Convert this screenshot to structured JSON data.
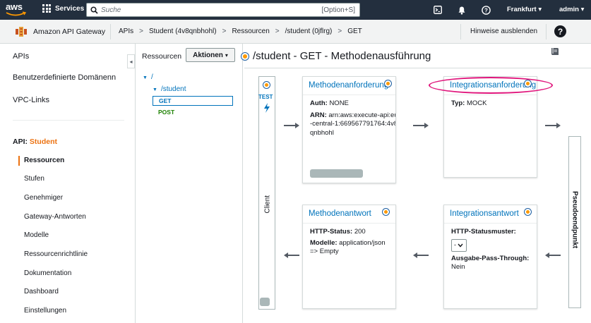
{
  "topnav": {
    "logo": "aws",
    "services_label": "Services",
    "search_placeholder": "Suche",
    "search_shortcut": "[Option+S]",
    "region": "Frankfurt",
    "user": "admin",
    "icons": [
      "terminal-icon",
      "bell-icon",
      "help-icon"
    ]
  },
  "breadcrumb": {
    "service_name": "Amazon API Gateway",
    "items": [
      "APIs",
      "Student (4v8qnbhohl)",
      "Ressourcen",
      "/student (0jflrg)",
      "GET"
    ],
    "separator": ">",
    "hide_hints": "Hinweise ausblenden"
  },
  "sidebar": {
    "top_items": [
      "APIs",
      "Benutzerdefinierte Domänenn",
      "VPC-Links"
    ],
    "api_prefix": "API:",
    "api_name": "Student",
    "sub_items": [
      "Ressourcen",
      "Stufen",
      "Genehmiger",
      "Gateway-Antworten",
      "Modelle",
      "Ressourcenrichtlinie",
      "Dokumentation",
      "Dashboard",
      "Einstellungen"
    ],
    "active": "Ressourcen"
  },
  "resources": {
    "title": "Ressourcen",
    "actions_label": "Aktionen",
    "tree": {
      "root": "/",
      "child": "/student",
      "methods": [
        "GET",
        "POST"
      ],
      "selected": "GET"
    }
  },
  "main": {
    "title": "/student - GET - Methodenausführung",
    "client": {
      "test_label": "TEST",
      "label": "Client"
    },
    "endpoint_label": "Pseudoendpunkt",
    "method_request": {
      "title": "Methodenanforderung",
      "auth_label": "Auth:",
      "auth_value": "NONE",
      "arn_label": "ARN:",
      "arn_value": "arn:aws:execute-api:eu-central-1:669567791764:4v8qnbhohl"
    },
    "integration_request": {
      "title": "Integrationsanforderung",
      "type_label": "Typ:",
      "type_value": "MOCK"
    },
    "method_response": {
      "title": "Methodenantwort",
      "status_label": "HTTP-Status:",
      "status_value": "200",
      "models_label": "Modelle:",
      "models_value": "application/json => Empty"
    },
    "integration_response": {
      "title": "Integrationsantwort",
      "pattern_label": "HTTP-Statusmuster:",
      "pattern_value": "-",
      "passthrough_label": "Ausgabe-Pass-Through:",
      "passthrough_value": "Nein"
    }
  },
  "colors": {
    "nav_bg": "#232f3e",
    "accent": "#ec7211",
    "link": "#0073bb",
    "post_green": "#1d8102",
    "highlight": "#e0167c",
    "marker": "#ff9900"
  }
}
